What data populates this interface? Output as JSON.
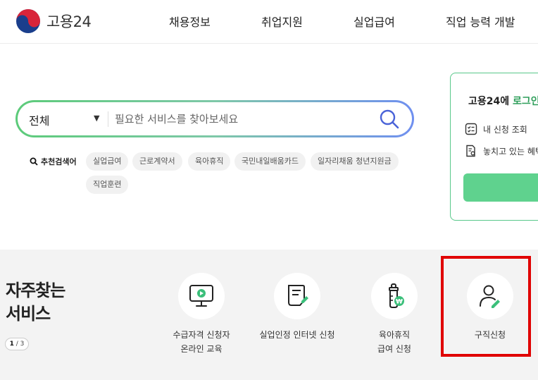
{
  "header": {
    "logo_text": "고용24",
    "nav": [
      "채용정보",
      "취업지원",
      "실업급여",
      "직업 능력 개발"
    ]
  },
  "search": {
    "scope": "전체",
    "placeholder": "필요한 서비스를 찾아보세요",
    "value": ""
  },
  "recommended": {
    "label": "추천검색어",
    "chips": [
      "실업급여",
      "근로계약서",
      "육아휴직",
      "국민내일배움카드",
      "일자리채움 청년지원금",
      "직업훈련"
    ]
  },
  "login_card": {
    "title_prefix": "고용24에 ",
    "title_accent": "로그인",
    "links": [
      "내 신청 조회",
      "놓치고 있는 혜택"
    ]
  },
  "services": {
    "title_line1": "자주찾는",
    "title_line2": "서비스",
    "pager_current": "1",
    "pager_total": "3",
    "items": [
      {
        "label": "수급자격 신청자\n온라인 교육",
        "icon": "monitor-play-icon"
      },
      {
        "label": "실업인정 인터넷 신청",
        "icon": "document-edit-icon"
      },
      {
        "label": "육아휴직\n급여 신청",
        "icon": "baby-bottle-won-icon"
      },
      {
        "label": "구직신청",
        "icon": "person-edit-icon"
      }
    ]
  },
  "colors": {
    "highlight": "#e00000",
    "accent_green": "#2e9e5a",
    "login_button": "#5fd28e"
  }
}
